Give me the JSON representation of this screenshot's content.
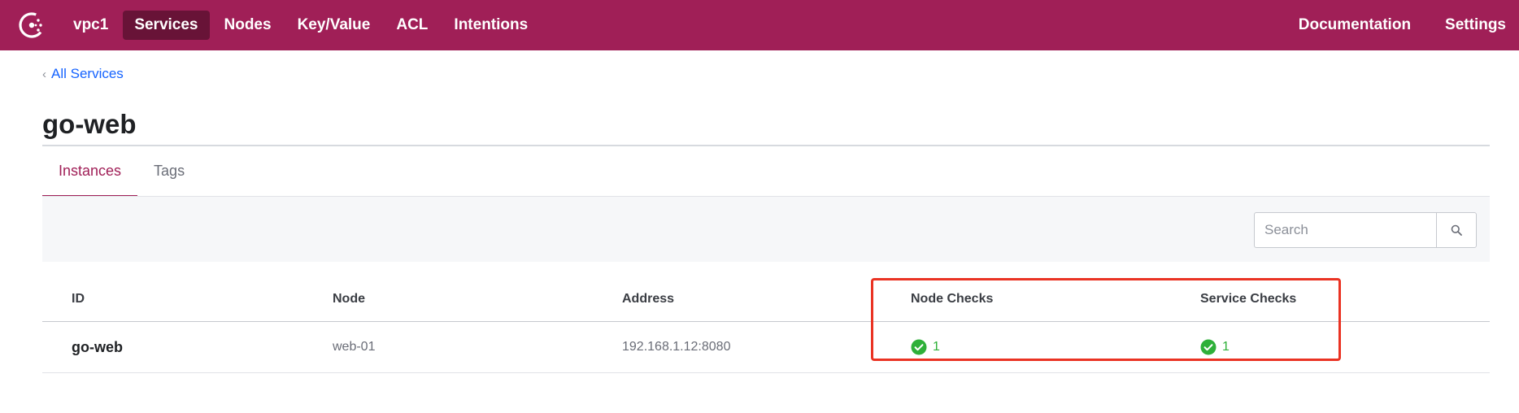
{
  "nav": {
    "logo_icon": "consul-logo-icon",
    "datacenter": "vpc1",
    "items": [
      "Services",
      "Nodes",
      "Key/Value",
      "ACL",
      "Intentions"
    ],
    "active_item": "Services",
    "right_items": [
      "Documentation",
      "Settings"
    ],
    "brand_color": "#a01f57",
    "active_bg": "#681337"
  },
  "breadcrumb": {
    "icon": "chevron-left-icon",
    "label": "All Services"
  },
  "page": {
    "title": "go-web"
  },
  "tabs": [
    {
      "label": "Instances",
      "active": true
    },
    {
      "label": "Tags",
      "active": false
    }
  ],
  "search": {
    "placeholder": "Search",
    "value": "",
    "icon": "search-icon"
  },
  "table": {
    "headers": [
      "ID",
      "Node",
      "Address",
      "Node Checks",
      "Service Checks"
    ],
    "rows": [
      {
        "id": "go-web",
        "node": "web-01",
        "address": "192.168.1.12:8080",
        "node_checks": "1",
        "service_checks": "1"
      }
    ]
  },
  "status_colors": {
    "passing": "#2eb039",
    "annotation": "#ea3323"
  }
}
